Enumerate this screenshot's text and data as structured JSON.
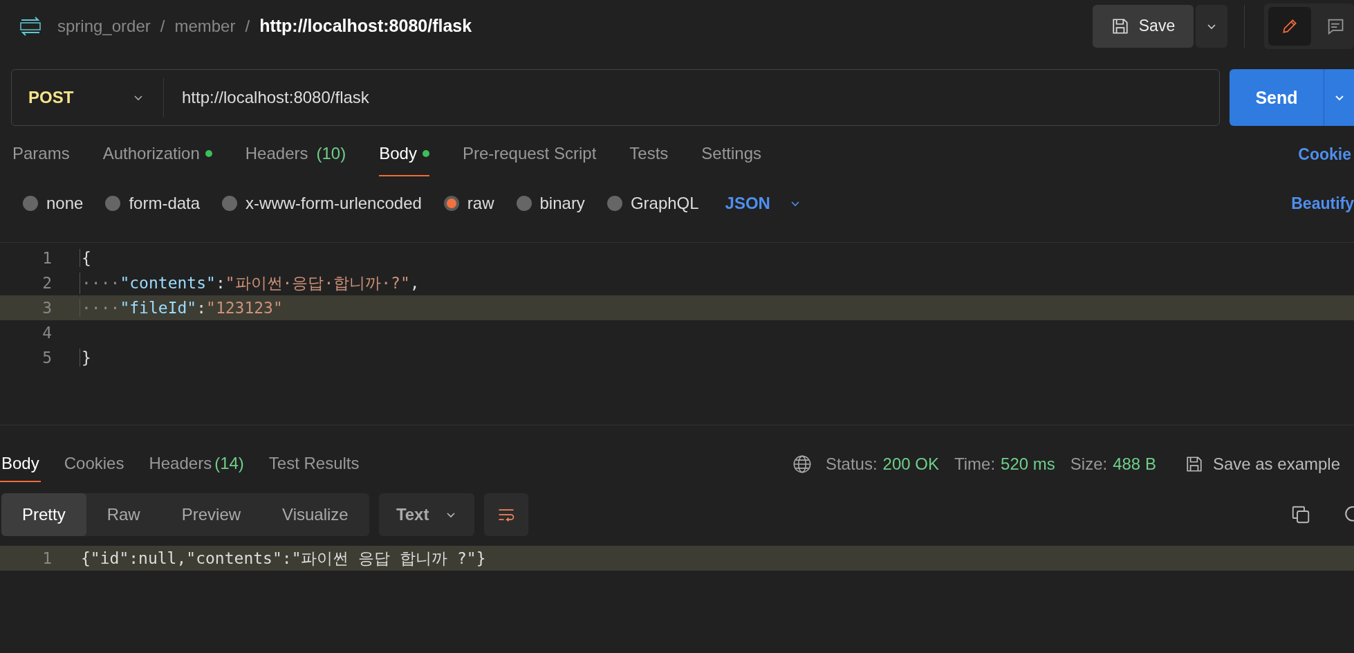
{
  "header": {
    "breadcrumb": [
      {
        "label": "spring_order",
        "current": false
      },
      {
        "label": "member",
        "current": false
      },
      {
        "label": "http://localhost:8080/flask",
        "current": true
      }
    ],
    "separator": "/",
    "save": "Save"
  },
  "request": {
    "method": "POST",
    "url": "http://localhost:8080/flask",
    "send": "Send"
  },
  "request_tabs": [
    {
      "label": "Params",
      "selected": false,
      "dot": false
    },
    {
      "label": "Authorization",
      "selected": false,
      "dot": true
    },
    {
      "label": "Headers",
      "count": "(10)",
      "selected": false,
      "dot": false
    },
    {
      "label": "Body",
      "selected": true,
      "dot": true
    },
    {
      "label": "Pre-request Script",
      "selected": false,
      "dot": false
    },
    {
      "label": "Tests",
      "selected": false,
      "dot": false
    },
    {
      "label": "Settings",
      "selected": false,
      "dot": false
    }
  ],
  "cookies_link": "Cookie",
  "mode_buttons": [
    {
      "kind": "edit",
      "selected": true
    },
    {
      "kind": "comment",
      "selected": false
    }
  ],
  "body_types": [
    {
      "label": "none",
      "selected": false
    },
    {
      "label": "form-data",
      "selected": false
    },
    {
      "label": "x-www-form-urlencoded",
      "selected": false
    },
    {
      "label": "raw",
      "selected": true
    },
    {
      "label": "binary",
      "selected": false
    },
    {
      "label": "GraphQL",
      "selected": false
    }
  ],
  "body_format": "JSON",
  "beautify": "Beautify",
  "editor": [
    {
      "number": "1",
      "highlighted": false,
      "tokens": [
        {
          "kind": "punct",
          "text": "{"
        }
      ]
    },
    {
      "number": "2",
      "highlighted": false,
      "tokens": [
        {
          "kind": "space",
          "text": "····"
        },
        {
          "kind": "key",
          "text": "\"contents\""
        },
        {
          "kind": "punct",
          "text": ":"
        },
        {
          "kind": "string",
          "text": "\"파이썬·응답·합니까·?\""
        },
        {
          "kind": "punct",
          "text": ","
        }
      ]
    },
    {
      "number": "3",
      "highlighted": true,
      "tokens": [
        {
          "kind": "space",
          "text": "····"
        },
        {
          "kind": "key",
          "text": "\"fileId\""
        },
        {
          "kind": "punct",
          "text": ":"
        },
        {
          "kind": "string",
          "text": "\"123123\""
        }
      ]
    },
    {
      "number": "4",
      "highlighted": false
    },
    {
      "number": "5",
      "highlighted": false,
      "tokens": [
        {
          "kind": "punct",
          "text": "}"
        }
      ]
    }
  ],
  "response_tabs": [
    {
      "label": "Body",
      "selected": true
    },
    {
      "label": "Cookies",
      "selected": false
    },
    {
      "label": "Headers",
      "count": "(14)",
      "selected": false
    },
    {
      "label": "Test Results",
      "selected": false
    }
  ],
  "response_meta": [
    {
      "label": "Status:",
      "value": "200 OK"
    },
    {
      "label": "Time:",
      "value": "520 ms"
    },
    {
      "label": "Size:",
      "value": "488 B"
    }
  ],
  "save_example": "Save as example",
  "view_modes": [
    {
      "label": "Pretty",
      "selected": true
    },
    {
      "label": "Raw",
      "selected": false
    },
    {
      "label": "Preview",
      "selected": false
    },
    {
      "label": "Visualize",
      "selected": false
    }
  ],
  "response_format": "Text",
  "response_lines": [
    {
      "number": "1",
      "highlighted": true,
      "text": "{\"id\":null,\"contents\":\"파이썬 응답 합니까 ?\"}"
    }
  ]
}
